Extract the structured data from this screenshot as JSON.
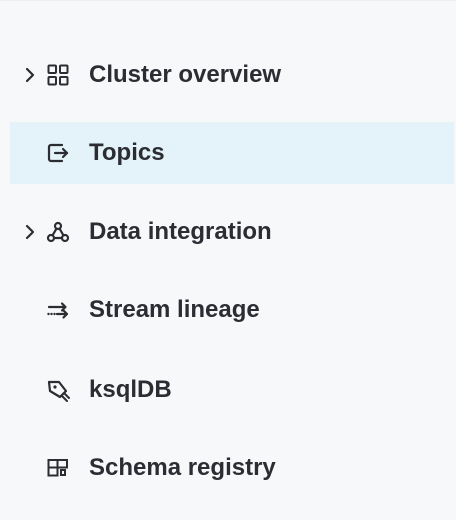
{
  "sidebar": {
    "items": [
      {
        "label": "Cluster overview",
        "icon": "grid-icon",
        "expandable": true,
        "active": false
      },
      {
        "label": "Topics",
        "icon": "topics-icon",
        "expandable": false,
        "active": true
      },
      {
        "label": "Data integration",
        "icon": "connector-icon",
        "expandable": true,
        "active": false
      },
      {
        "label": "Stream lineage",
        "icon": "lineage-icon",
        "expandable": false,
        "active": false
      },
      {
        "label": "ksqlDB",
        "icon": "ksqldb-icon",
        "expandable": false,
        "active": false
      },
      {
        "label": "Schema registry",
        "icon": "schema-icon",
        "expandable": false,
        "active": false
      }
    ]
  },
  "colors": {
    "background": "#f7f8fa",
    "active_background": "#e4f3f9",
    "text": "#2b2d33"
  }
}
